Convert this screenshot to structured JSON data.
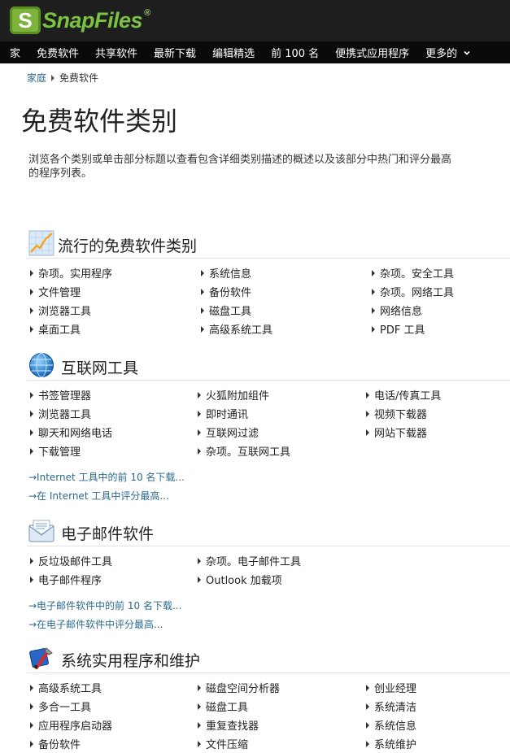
{
  "brand": {
    "logo_letter": "S",
    "logo_name": "SnapFiles",
    "logo_mark": "®"
  },
  "nav": [
    "家",
    "免费软件",
    "共享软件",
    "最新下载",
    "编辑精选",
    "前 100 名",
    "便携式应用程序",
    "更多的"
  ],
  "nav_more_icon": "chevron-down-icon",
  "breadcrumb": {
    "home": "家庭",
    "current": "免费软件"
  },
  "page_title": "免费软件类别",
  "intro": [
    "浏览各个类别或单击部分标题以查看包含详细类别描述的概述以及该部分中热门和评分最高",
    "的程序列表。"
  ],
  "sections": [
    {
      "title": "流行的免费软件类别",
      "icon": "trending-chart-icon",
      "columns": [
        [
          "杂项。实用程序",
          "文件管理",
          "浏览器工具",
          "桌面工具"
        ],
        [
          "系统信息",
          "备份软件",
          "磁盘工具",
          "高级系统工具"
        ],
        [
          "杂项。安全工具",
          "杂项。网络工具",
          "网络信息",
          "PDF 工具"
        ]
      ],
      "links": []
    },
    {
      "title": "互联网工具",
      "icon": "globe-icon",
      "columns": [
        [
          "书签管理器",
          "浏览器工具",
          "聊天和网络电话",
          "下载管理"
        ],
        [
          "火狐附加组件",
          "即时通讯",
          "互联网过滤",
          "杂项。互联网工具"
        ],
        [
          "电话/传真工具",
          "视频下载器",
          "网站下载器"
        ]
      ],
      "links": [
        "→Internet 工具中的前 10 名下载...",
        "→在 Internet 工具中评分最高..."
      ]
    },
    {
      "title": "电子邮件软件",
      "icon": "envelope-icon",
      "columns": [
        [
          "反垃圾邮件工具",
          "电子邮件程序"
        ],
        [
          "杂项。电子邮件工具",
          "Outlook 加载项"
        ]
      ],
      "links": [
        "→电子邮件软件中的前 10 名下载...",
        "→在电子邮件软件中评分最高..."
      ]
    },
    {
      "title": "系统实用程序和维护",
      "icon": "system-tools-icon",
      "columns": [
        [
          "高级系统工具",
          "多合一工具",
          "应用程序启动器",
          "备份软件"
        ],
        [
          "磁盘空间分析器",
          "磁盘工具",
          "重复查找器",
          "文件压缩"
        ],
        [
          "创业经理",
          "系统清洁",
          "系统信息",
          "系统维护"
        ]
      ],
      "links": []
    }
  ],
  "colors": {
    "nav_bg": "#0a0a0a",
    "header_bg": "#1e1e1e",
    "brand_green": "#7cc242",
    "link": "#2b6a8d"
  }
}
